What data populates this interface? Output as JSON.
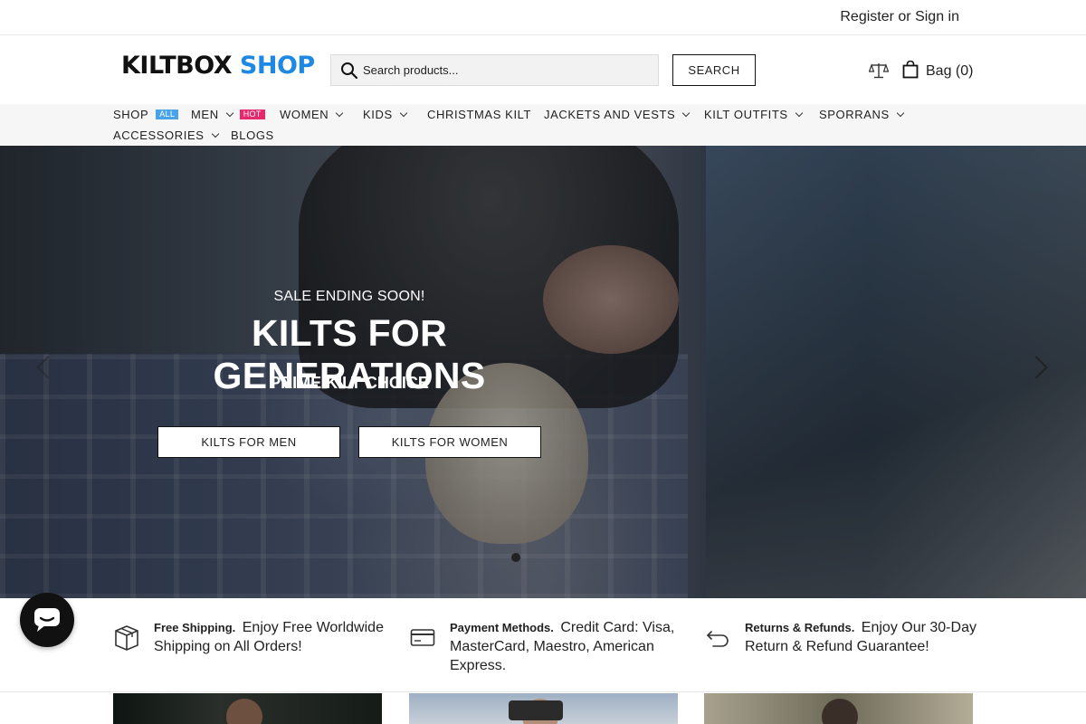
{
  "topbar": {
    "register_label": "Register",
    "or_label": " or ",
    "signin_label": "Sign in"
  },
  "header": {
    "logo_part1": "KILTBOX",
    "logo_part2": "SHOP",
    "search_placeholder": "Search products...",
    "search_button": "SEARCH",
    "bag_label": "Bag (0)"
  },
  "nav": {
    "items": [
      {
        "label": "SHOP",
        "badge": "ALL"
      },
      {
        "label": "MEN",
        "badge": "HOT"
      },
      {
        "label": "WOMEN"
      },
      {
        "label": "KIDS"
      },
      {
        "label": "CHRISTMAS KILT"
      },
      {
        "label": "JACKETS AND VESTS"
      },
      {
        "label": "KILT OUTFITS"
      },
      {
        "label": "SPORRANS"
      },
      {
        "label": "ACCESSORIES"
      },
      {
        "label": "BLOGS"
      }
    ]
  },
  "hero": {
    "eyebrow": "SALE ENDING SOON!",
    "title": "KILTS FOR GENERATIONS",
    "subtitle": "PRIME KILT CHOICE",
    "button_men": "KILTS FOR MEN",
    "button_women": "KILTS FOR WOMEN"
  },
  "features": [
    {
      "icon": "box-icon",
      "title": "Free Shipping.",
      "text": "Enjoy Free Worldwide Shipping on All Orders!"
    },
    {
      "icon": "credit-card-icon",
      "title": "Payment Methods.",
      "text": "Credit Card: Visa, MasterCard, Maestro, American Express."
    },
    {
      "icon": "return-arrow-icon",
      "title": "Returns & Refunds.",
      "text": "Enjoy Our 30-Day Return & Refund Guarantee!"
    }
  ],
  "colors": {
    "logo_accent": "#1e88e5",
    "badge_all": "#4aa3e8",
    "badge_hot": "#e8286d"
  }
}
